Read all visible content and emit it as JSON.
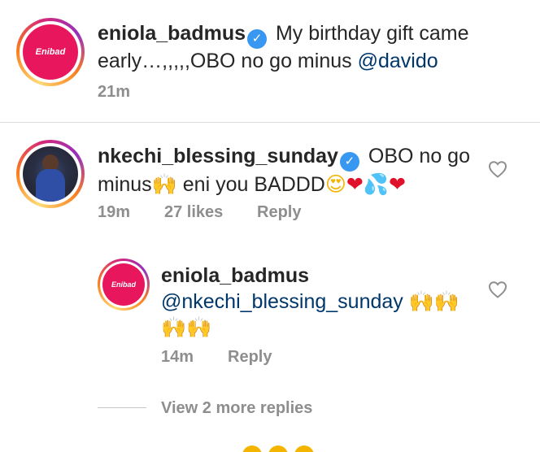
{
  "caption": {
    "username": "eniola_badmus",
    "text": "My birthday gift came early…,,,,,OBO no go minus",
    "mention": "@davido",
    "time": "21m",
    "avatar_logo": "Enibad"
  },
  "comment": {
    "username": "nkechi_blessing_sunday",
    "text_1": "OBO no go minus",
    "text_2": "eni you BADDD",
    "time": "19m",
    "likes": "27 likes",
    "reply_label": "Reply"
  },
  "reply": {
    "username": "eniola_badmus",
    "mention": "@nkechi_blessing_sunday",
    "time": "14m",
    "reply_label": "Reply",
    "avatar_logo": "Enibad"
  },
  "view_more": "View 2 more replies",
  "icons": {
    "verified": "verified-badge-icon",
    "like": "heart-outline-icon"
  },
  "colors": {
    "mention": "#00376b",
    "meta": "#8e8e8e",
    "verified": "#3897f0",
    "brand_pink": "#e8175d"
  }
}
